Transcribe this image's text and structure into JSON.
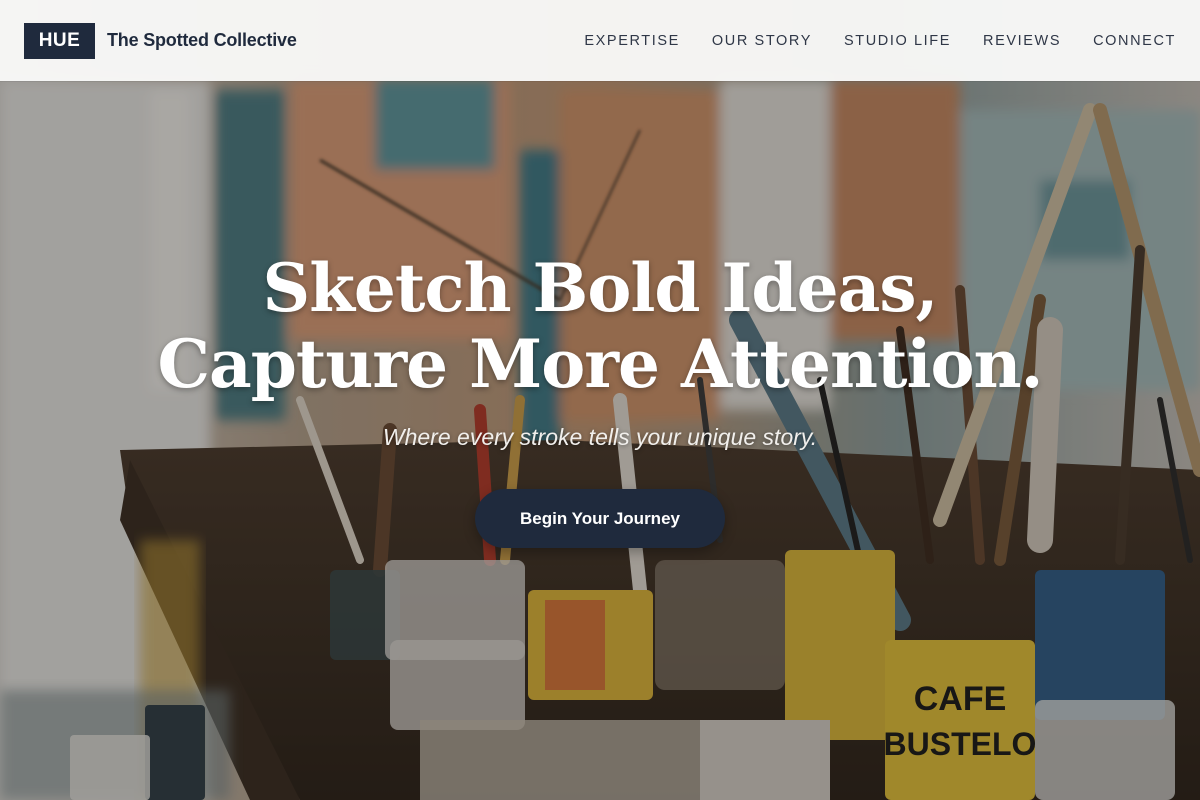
{
  "header": {
    "logo": "HUE",
    "brand_name": "The Spotted Collective",
    "nav": [
      {
        "label": "EXPERTISE"
      },
      {
        "label": "OUR STORY"
      },
      {
        "label": "STUDIO LIFE"
      },
      {
        "label": "REVIEWS"
      },
      {
        "label": "CONNECT"
      }
    ]
  },
  "hero": {
    "headline_line1": "Sketch Bold Ideas,",
    "headline_line2": "Capture More Attention.",
    "tagline": "Where every stroke tells your unique story.",
    "cta_label": "Begin Your Journey",
    "background_image": "artist-studio-paint-brushes-photo",
    "can_label_top": "CAFE",
    "can_label_bottom": "BUSTELO"
  },
  "colors": {
    "primary": "#1f2a3d",
    "header_bg": "#f8f8f7",
    "nav_text": "#2f3747",
    "hero_text": "#ffffff"
  }
}
